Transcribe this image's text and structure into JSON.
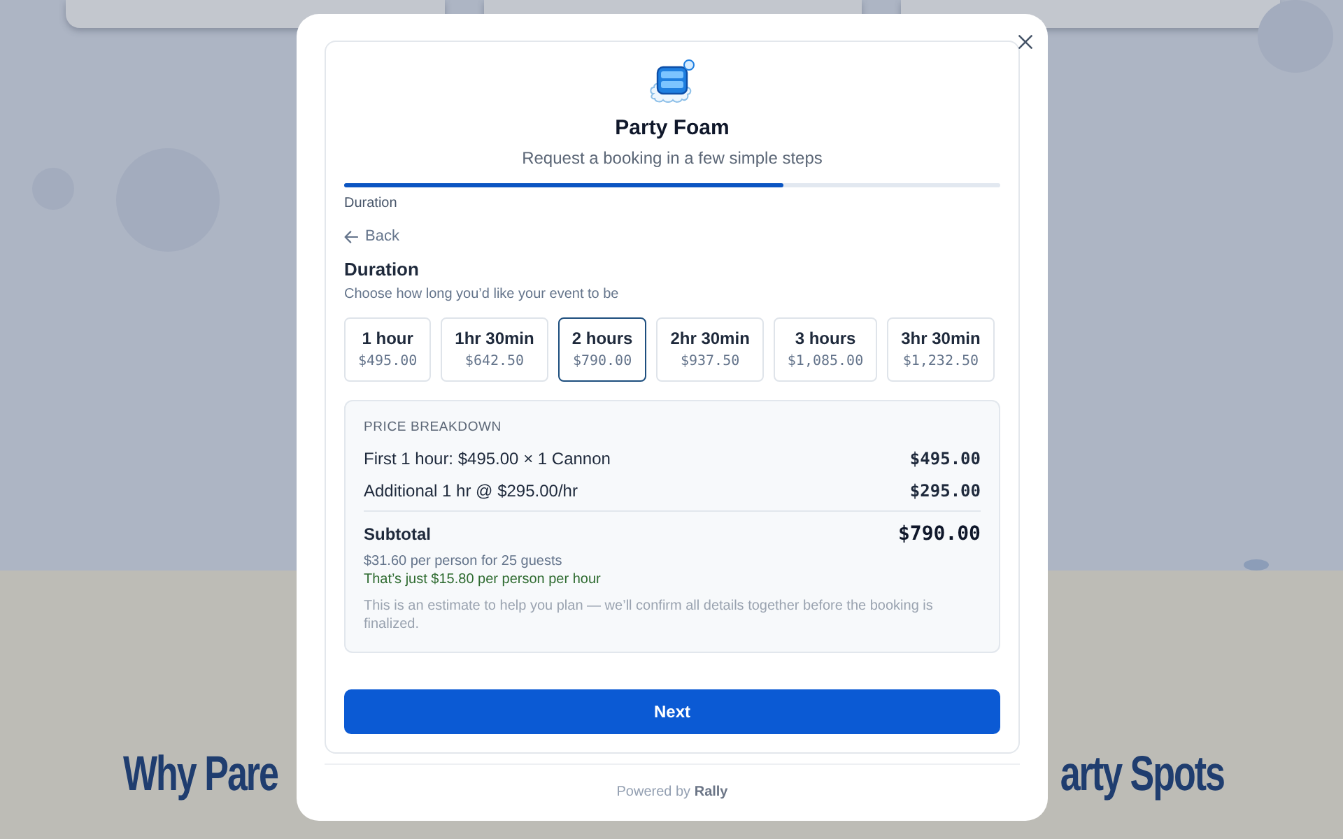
{
  "backdrop": {
    "heading_left": "Why Pare",
    "heading_right": "arty Spots"
  },
  "dialog": {
    "title": "Party Foam",
    "subtitle": "Request a booking in a few simple steps",
    "progress": {
      "level": 0.67,
      "label": "Duration"
    },
    "back_link": "Back",
    "step": {
      "title": "Duration",
      "description": "Choose how long you’d like your event to be"
    },
    "duration_options": [
      {
        "label": "1 hour",
        "price": "$495.00",
        "selected": false
      },
      {
        "label": "1hr 30min",
        "price": "$642.50",
        "selected": false
      },
      {
        "label": "2 hours",
        "price": "$790.00",
        "selected": true
      },
      {
        "label": "2hr 30min",
        "price": "$937.50",
        "selected": false
      },
      {
        "label": "3 hours",
        "price": "$1,085.00",
        "selected": false
      },
      {
        "label": "3hr 30min",
        "price": "$1,232.50",
        "selected": false
      }
    ],
    "price_breakdown": {
      "title": "PRICE BREAKDOWN",
      "lines": [
        {
          "label": "First 1 hour: $495.00 × 1 Cannon",
          "amount": "$495.00"
        },
        {
          "label": "Additional 1 hr @ $295.00/hr",
          "amount": "$295.00"
        }
      ],
      "subtotal": {
        "label": "Subtotal",
        "amount": "$790.00"
      },
      "per_person": "$31.60 per person for 25 guests",
      "per_hour": "That’s just $15.80 per person per hour",
      "note": "This is an estimate to help you plan — we’ll confirm all details together before the booking is finalized."
    },
    "next_button": "Next",
    "footer": "Powered by **Rally**"
  }
}
